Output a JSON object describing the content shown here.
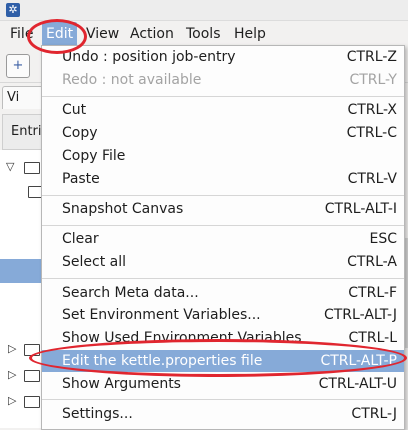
{
  "menubar": {
    "items": [
      {
        "label": "File"
      },
      {
        "label": "Edit"
      },
      {
        "label": "View"
      },
      {
        "label": "Action"
      },
      {
        "label": "Tools"
      },
      {
        "label": "Help"
      }
    ]
  },
  "background": {
    "tab_label": "Vi",
    "panel_header": "Entri"
  },
  "edit_menu": {
    "items": [
      {
        "label": "Undo : position job-entry",
        "shortcut": "CTRL-Z",
        "enabled": true
      },
      {
        "label": "Redo : not available",
        "shortcut": "CTRL-Y",
        "enabled": false
      },
      {
        "label": "Cut",
        "shortcut": "CTRL-X",
        "enabled": true
      },
      {
        "label": "Copy",
        "shortcut": "CTRL-C",
        "enabled": true
      },
      {
        "label": "Copy File",
        "shortcut": "",
        "enabled": true
      },
      {
        "label": "Paste",
        "shortcut": "CTRL-V",
        "enabled": true
      },
      {
        "label": "Snapshot Canvas",
        "shortcut": "CTRL-ALT-I",
        "enabled": true
      },
      {
        "label": "Clear",
        "shortcut": "ESC",
        "enabled": true
      },
      {
        "label": "Select all",
        "shortcut": "CTRL-A",
        "enabled": true
      },
      {
        "label": "Search Meta data...",
        "shortcut": "CTRL-F",
        "enabled": true
      },
      {
        "label": "Set Environment Variables...",
        "shortcut": "CTRL-ALT-J",
        "enabled": true
      },
      {
        "label": "Show Used Environment Variables",
        "shortcut": "CTRL-L",
        "enabled": true
      },
      {
        "label": "Edit the kettle.properties file",
        "shortcut": "CTRL-ALT-P",
        "enabled": true,
        "highlighted": true
      },
      {
        "label": "Show Arguments",
        "shortcut": "CTRL-ALT-U",
        "enabled": true
      },
      {
        "label": "Settings...",
        "shortcut": "CTRL-J",
        "enabled": true
      }
    ]
  },
  "colors": {
    "highlight": "#86aad8",
    "annotation": "#e0262f"
  }
}
